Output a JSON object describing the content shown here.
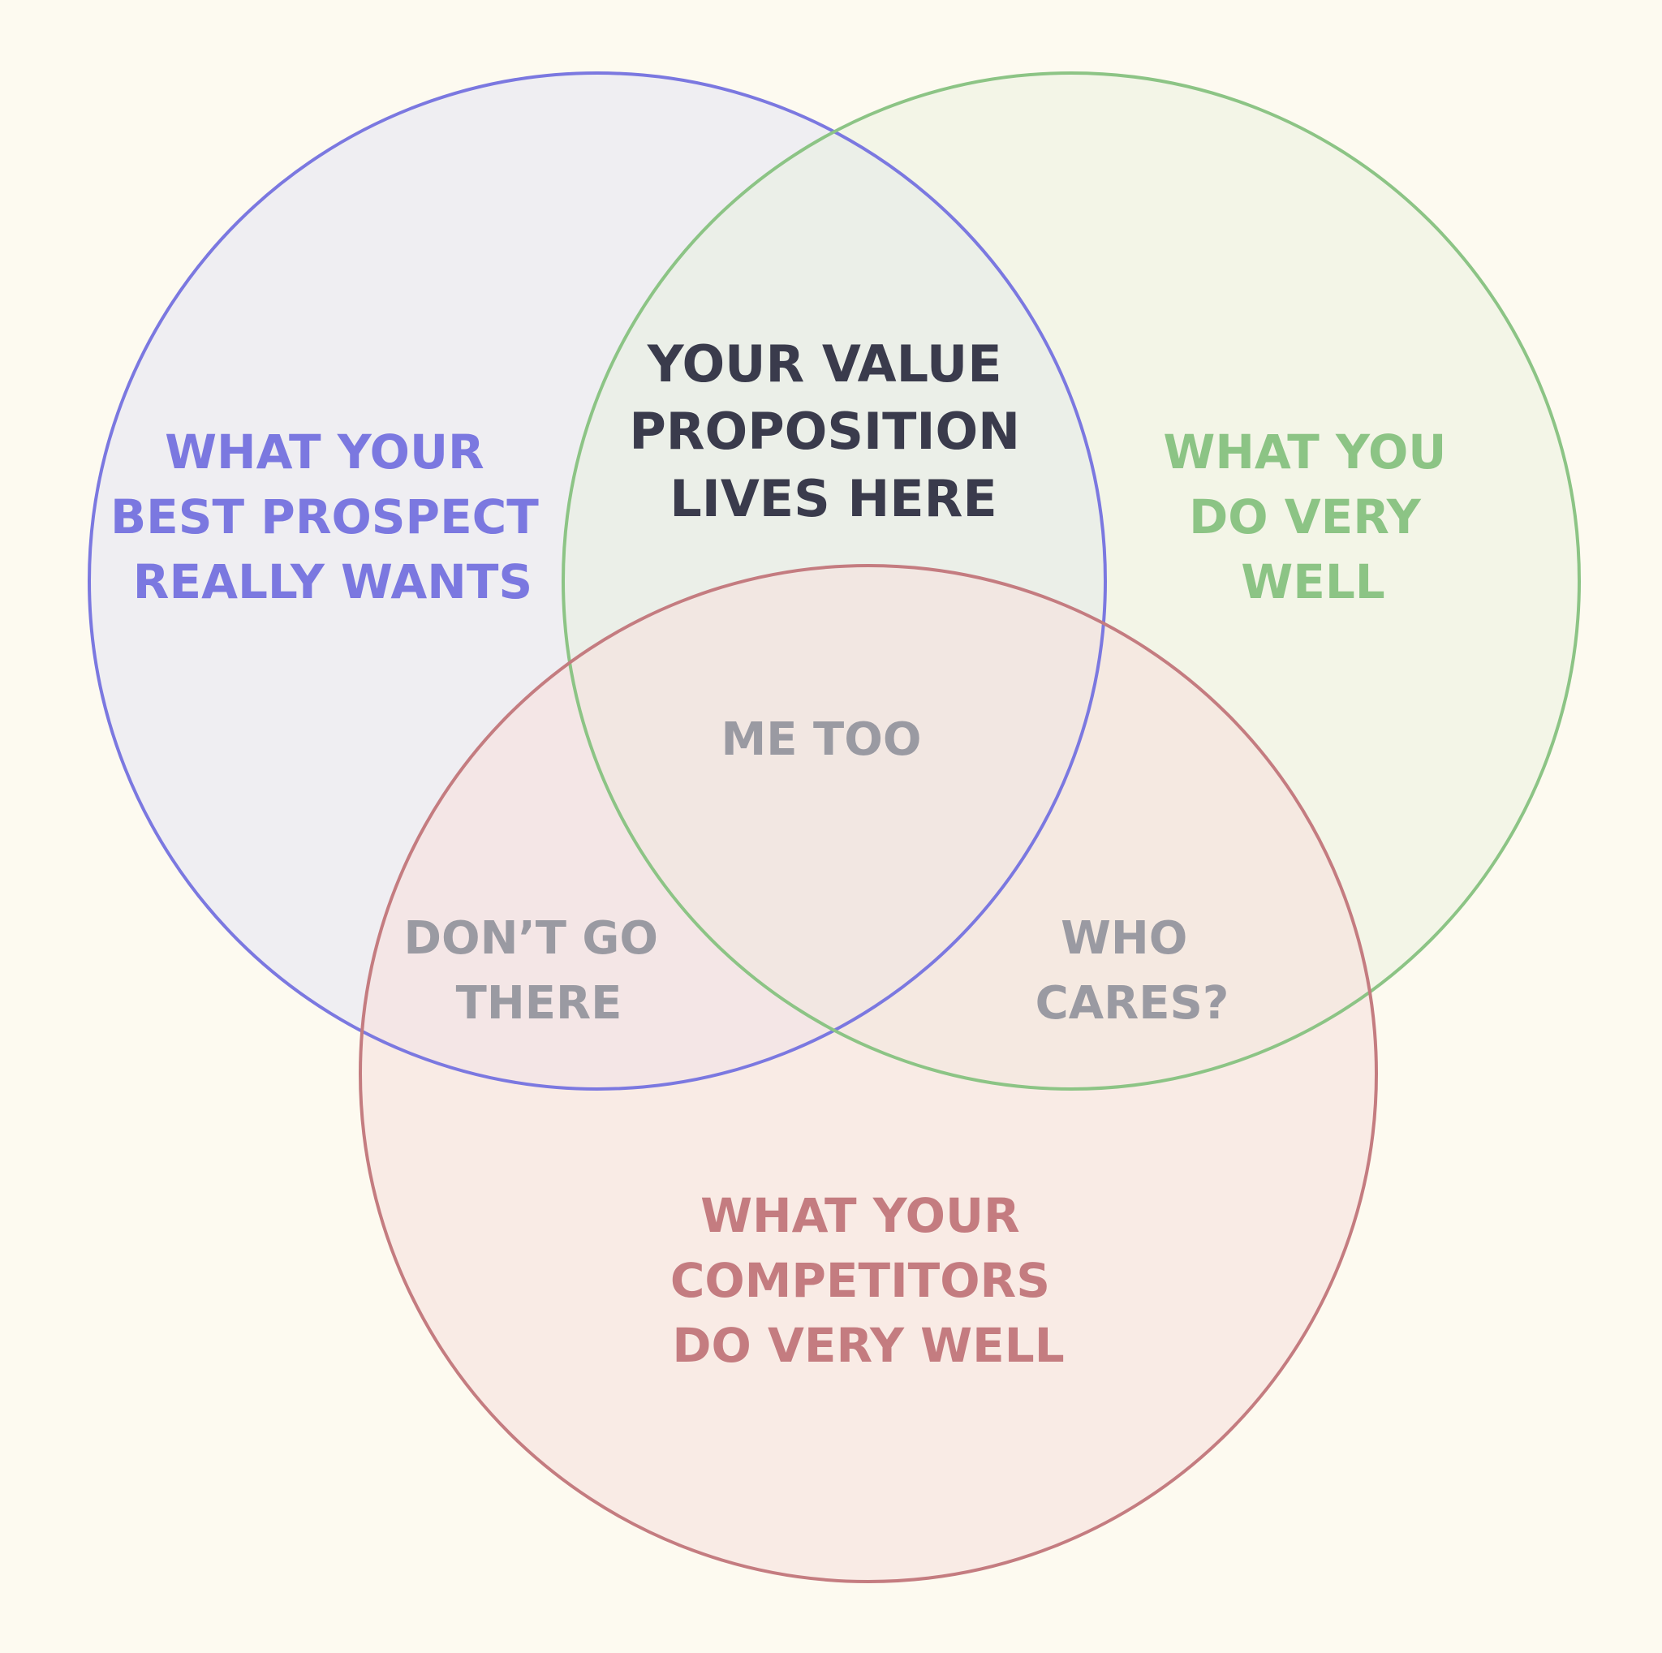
{
  "colors": {
    "background": "#fdfaf0",
    "prospect": "#7b78e0",
    "you": "#8cc485",
    "competitors": "#c47c80",
    "value": "#3a3b4c",
    "muted": "#9a9aa2"
  },
  "circles": {
    "prospect": {
      "lines": [
        "WHAT YOUR",
        "BEST PROSPECT",
        "REALLY WANTS"
      ]
    },
    "you": {
      "lines": [
        "WHAT YOU",
        "DO VERY",
        "WELL"
      ]
    },
    "competitors": {
      "lines": [
        "WHAT YOUR",
        "COMPETITORS",
        "DO VERY WELL"
      ]
    }
  },
  "overlaps": {
    "value": {
      "lines": [
        "YOUR VALUE",
        "PROPOSITION",
        "LIVES HERE"
      ]
    },
    "me_too": {
      "lines": [
        "ME TOO"
      ]
    },
    "dont_go": {
      "lines": [
        "DON’T GO",
        "THERE"
      ]
    },
    "who_cares": {
      "lines": [
        "WHO",
        "CARES?"
      ]
    }
  }
}
